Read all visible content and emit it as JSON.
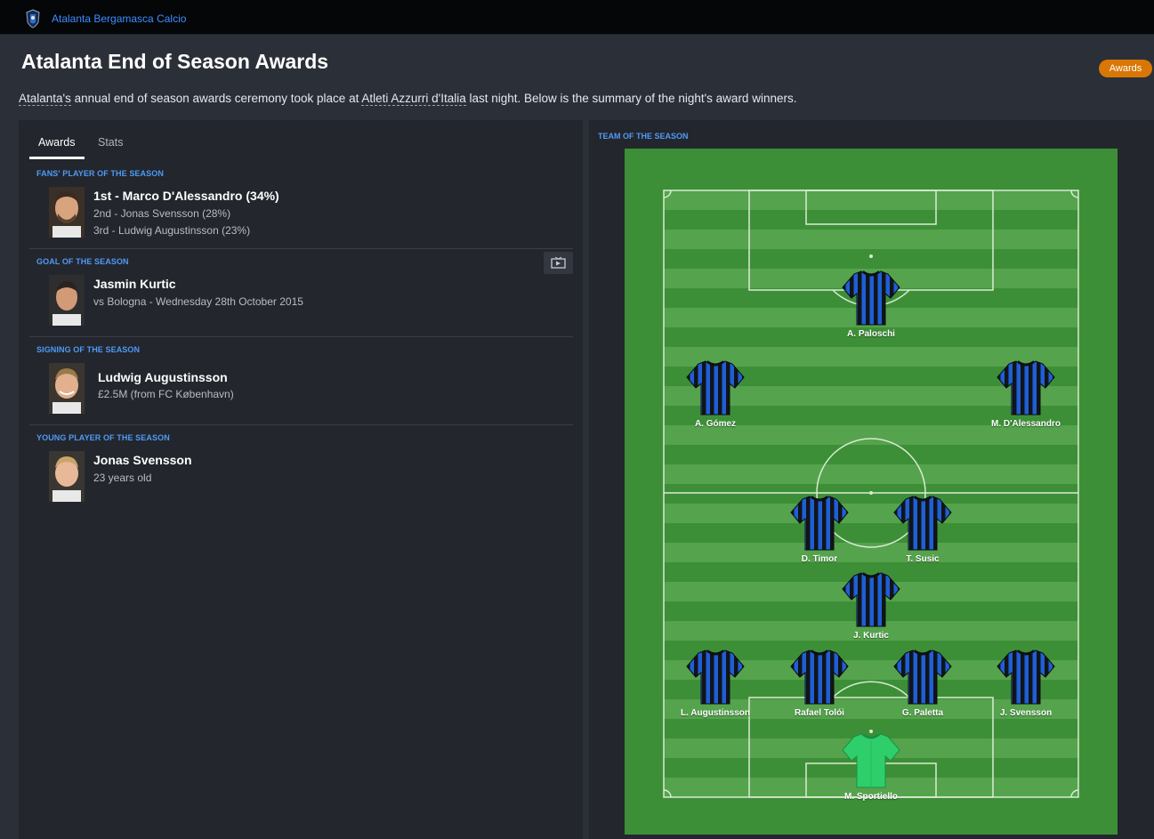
{
  "header": {
    "club_name": "Atalanta Bergamasca Calcio"
  },
  "page": {
    "title": "Atalanta End of Season Awards",
    "badge": "Awards",
    "intro": {
      "club": "Atalanta's",
      "text1": " annual end of season awards ceremony took place at ",
      "venue": "Atleti Azzurri d'Italia",
      "text2": " last night. Below is the summary of the night's award winners."
    }
  },
  "tabs": {
    "awards": "Awards",
    "stats": "Stats"
  },
  "awards": {
    "fans_player": {
      "label": "FANS' PLAYER OF THE SEASON",
      "first": "1st - Marco D'Alessandro (34%)",
      "second": "2nd - Jonas Svensson (28%)",
      "third": "3rd - Ludwig Augustinsson (23%)"
    },
    "goal": {
      "label": "GOAL OF THE SEASON",
      "player": "Jasmin Kurtic",
      "detail": "vs Bologna - Wednesday 28th October 2015"
    },
    "signing": {
      "label": "SIGNING OF THE SEASON",
      "player": "Ludwig Augustinsson",
      "detail": "£2.5M (from FC København)"
    },
    "young": {
      "label": "YOUNG PLAYER OF THE SEASON",
      "player": "Jonas Svensson",
      "detail": "23 years old"
    }
  },
  "team_of_season": {
    "label": "TEAM OF THE SEASON",
    "players": {
      "paloschi": "A. Paloschi",
      "gomez": "A. Gómez",
      "dalessandro": "M. D'Alessandro",
      "timor": "D. Timor",
      "susic": "T. Susic",
      "kurtic": "J. Kurtic",
      "augustinsson": "L. Augustinsson",
      "toloi": "Rafael Tolói",
      "paletta": "G. Paletta",
      "svensson": "J. Svensson",
      "sportiello": "M. Sportiello"
    }
  },
  "colors": {
    "accent_blue": "#4e9bf5",
    "badge_orange": "#d97706",
    "pitch_green": "#3d8f37",
    "kit_blue": "#1f5fd6",
    "keeper_green": "#2ecf6a"
  }
}
